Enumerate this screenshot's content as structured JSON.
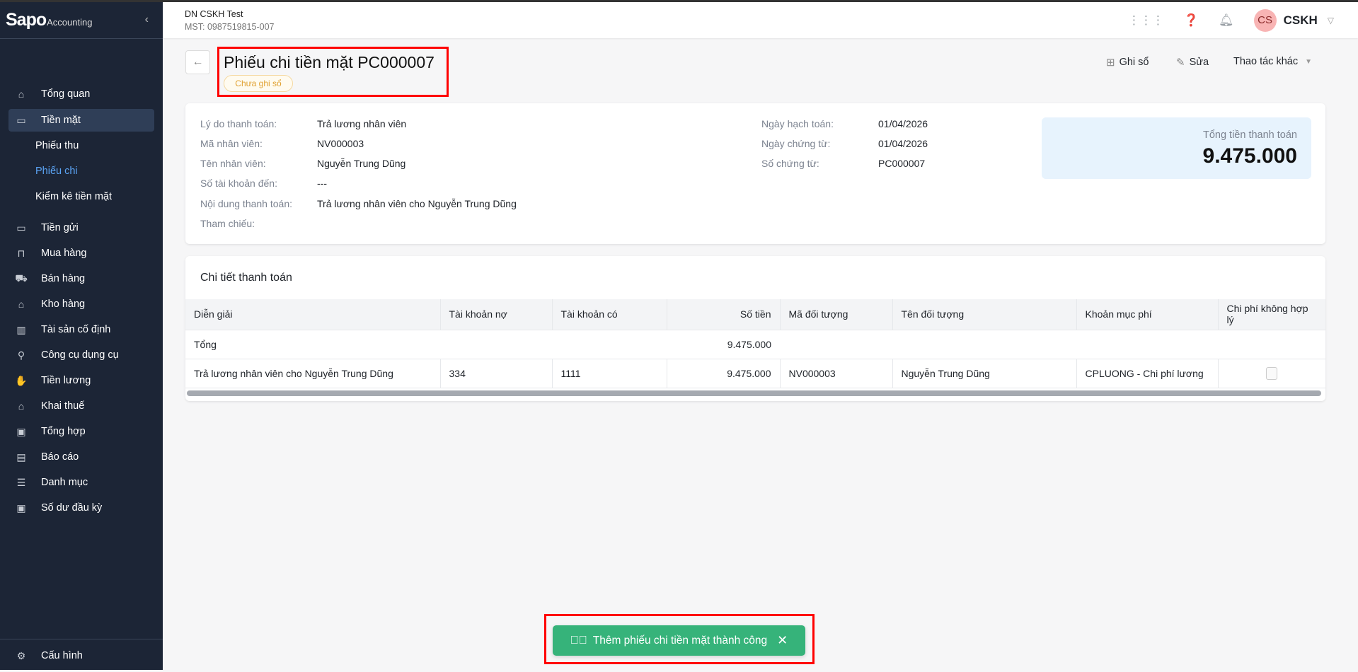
{
  "brand": {
    "logo": "Sapo",
    "sub": "Accounting"
  },
  "sidebar": {
    "items": [
      {
        "label": "Tổng quan",
        "icon": "home-icon"
      },
      {
        "label": "Tiền mặt",
        "icon": "cash-icon",
        "active": true
      },
      {
        "label": "Tiền gửi",
        "icon": "card-icon"
      },
      {
        "label": "Mua hàng",
        "icon": "bag-icon"
      },
      {
        "label": "Bán hàng",
        "icon": "cart-icon"
      },
      {
        "label": "Kho hàng",
        "icon": "warehouse-icon"
      },
      {
        "label": "Tài sản cố định",
        "icon": "building-icon"
      },
      {
        "label": "Công cụ dụng cụ",
        "icon": "tool-icon"
      },
      {
        "label": "Tiền lương",
        "icon": "salary-icon"
      },
      {
        "label": "Khai thuế",
        "icon": "bank-icon"
      },
      {
        "label": "Tổng hợp",
        "icon": "ledger-icon"
      },
      {
        "label": "Báo cáo",
        "icon": "report-icon"
      },
      {
        "label": "Danh mục",
        "icon": "list-icon"
      },
      {
        "label": "Số dư đầu kỳ",
        "icon": "wallet-icon"
      }
    ],
    "sub_items": [
      {
        "label": "Phiếu thu"
      },
      {
        "label": "Phiếu chi",
        "active": true
      },
      {
        "label": "Kiểm kê tiền mặt"
      }
    ],
    "settings": "Cấu hình"
  },
  "header": {
    "company": "DN CSKH Test",
    "tax_id": "MST: 0987519815-007",
    "avatar": "CS",
    "user": "CSKH"
  },
  "page": {
    "title": "Phiếu chi tiền mặt PC000007",
    "status": "Chưa ghi sổ",
    "actions": {
      "post": "Ghi sổ",
      "edit": "Sửa",
      "more": "Thao tác khác"
    }
  },
  "info": {
    "left": [
      {
        "label": "Lý do thanh toán:",
        "value": "Trả lương nhân viên"
      },
      {
        "label": "Mã nhân viên:",
        "value": "NV000003"
      },
      {
        "label": "Tên nhân viên:",
        "value": "Nguyễn Trung Dũng"
      },
      {
        "label": "Số tài khoản đến:",
        "value": "---"
      },
      {
        "label": "Nội dung thanh toán:",
        "value": "Trả lương nhân viên cho Nguyễn Trung Dũng"
      },
      {
        "label": "Tham chiếu:",
        "value": ""
      }
    ],
    "right": [
      {
        "label": "Ngày hạch toán:",
        "value": "01/04/2026"
      },
      {
        "label": "Ngày chứng từ:",
        "value": "01/04/2026"
      },
      {
        "label": "Số chứng từ:",
        "value": "PC000007"
      }
    ],
    "total_label": "Tổng tiền thanh toán",
    "total_value": "9.475.000"
  },
  "details": {
    "title": "Chi tiết thanh toán",
    "columns": [
      "Diễn giải",
      "Tài khoản nợ",
      "Tài khoản có",
      "Số tiền",
      "Mã đối tượng",
      "Tên đối tượng",
      "Khoản mục phí",
      "Chi phí không hợp lý"
    ],
    "sum_row": {
      "label": "Tổng",
      "amount": "9.475.000"
    },
    "rows": [
      {
        "desc": "Trả lương nhân viên cho Nguyễn Trung Dũng",
        "debit": "334",
        "credit": "1111",
        "amount": "9.475.000",
        "obj_code": "NV000003",
        "obj_name": "Nguyễn Trung Dũng",
        "expense": "CPLUONG - Chi phí lương",
        "unreasonable": false
      }
    ]
  },
  "toast": {
    "message": "Thêm phiếu chi tiền mặt thành công"
  },
  "colors": {
    "sidebar": "#1c2536",
    "accent": "#5ba4f5",
    "success": "#36b37a",
    "badge": "#e0a030"
  }
}
